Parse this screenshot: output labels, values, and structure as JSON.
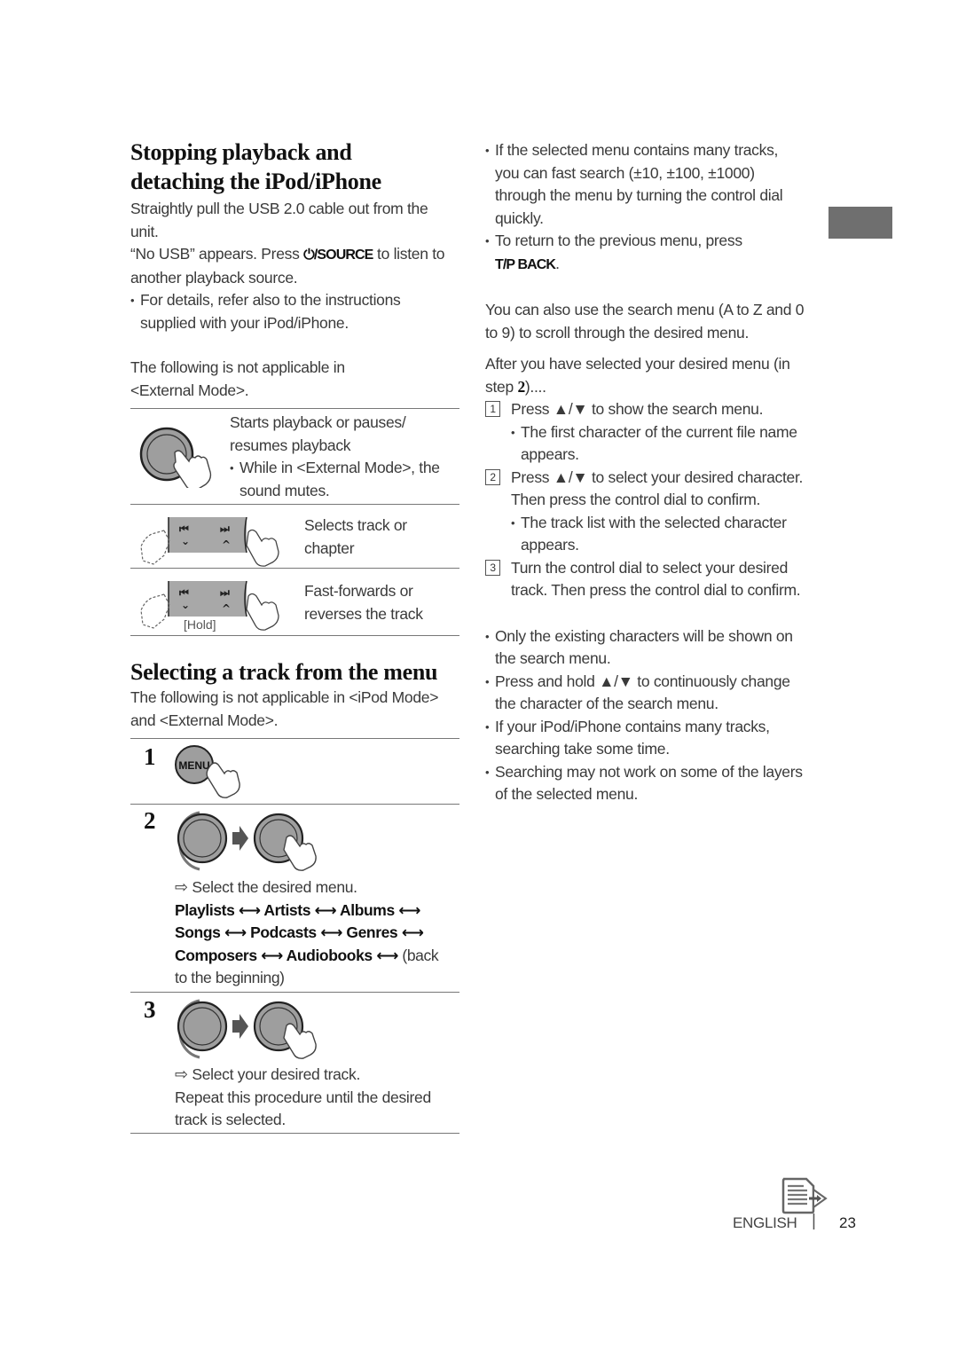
{
  "left": {
    "section1": {
      "title_line1": "Stopping playback and",
      "title_line2": "detaching the iPod/iPhone",
      "p1_line1": "Straightly pull the USB 2.0 cable out from the",
      "p1_line2": "unit.",
      "p2_pre": "“No USB” appears. Press ",
      "p2_key": "/SOURCE",
      "p2_post": " to listen to",
      "p2_line2": "another playback source.",
      "bullet_line1": "For details, refer also to the instructions",
      "bullet_line2": "supplied with your iPod/iPhone.",
      "note_line1": "The following is not applicable in",
      "note_line2": "<External Mode>.",
      "rows": [
        {
          "line1": "Starts playback or pauses/",
          "line2": "resumes playback",
          "bullet1": "While in <External Mode>, the",
          "bullet2": "sound mutes."
        },
        {
          "line1": "Selects track or",
          "line2": "chapter"
        },
        {
          "line1": "Fast-forwards or",
          "line2": "reverses the track",
          "hold": "[Hold]"
        }
      ]
    },
    "section2": {
      "title": "Selecting a track from the menu",
      "note_line1": "The following is not applicable in <iPod Mode>",
      "note_line2": "and <External Mode>.",
      "menu_button": "MENU",
      "steps": [
        {
          "num": "1"
        },
        {
          "num": "2",
          "result": "Select the desired menu.",
          "menu_items": [
            "Playlists",
            "Artists",
            "Albums",
            "Songs",
            "Podcasts",
            "Genres",
            "Composers",
            "Audiobooks"
          ],
          "tail_a": "(back",
          "tail_b": "to the beginning)"
        },
        {
          "num": "3",
          "result": "Select your desired track.",
          "line1": "Repeat this procedure until the desired",
          "line2": "track is selected."
        }
      ]
    }
  },
  "right": {
    "b1_l1": "If the selected menu contains many tracks,",
    "b1_l2": "you can fast search (±10, ±100, ±1000)",
    "b1_l3": "through the menu by turning the control dial",
    "b1_l4": "quickly.",
    "b2_l1": "To return to the previous menu, press",
    "b2_key": "T/P BACK",
    "p1_l1": "You can also use the search menu (A to Z and 0",
    "p1_l2": "to 9) to scroll through the desired menu.",
    "p2_l1": "After you have selected your desired menu (in",
    "p2_l2_pre": "step ",
    "p2_l2_bold": "2",
    "p2_l2_post": ")....",
    "steps": [
      {
        "num": "1",
        "line1": "Press ▲/▼ to show the search menu.",
        "sub1": "The first character of the current file name",
        "sub2": "appears."
      },
      {
        "num": "2",
        "line1": "Press ▲/▼ to select your desired character.",
        "line2": "Then press the control dial to confirm.",
        "sub1": "The track list with the selected character",
        "sub2": "appears."
      },
      {
        "num": "3",
        "line1": "Turn the control dial to select your desired",
        "line2": "track. Then press the control dial to confirm."
      }
    ],
    "notes": [
      {
        "l1": "Only the existing characters will be shown on",
        "l2": "the search menu."
      },
      {
        "l1": "Press and hold ▲/▼ to continuously change",
        "l2": "the character of the search menu."
      },
      {
        "l1": "If your iPod/iPhone contains many tracks,",
        "l2": "searching take some time."
      },
      {
        "l1": "Searching may not work on some of the layers",
        "l2": "of the selected menu."
      }
    ]
  },
  "footer": {
    "language": "ENGLISH",
    "separator": "|",
    "page_number": "23",
    "icon": "next-page-document-icon"
  },
  "colors": {
    "side_tab": "#6f6f6f",
    "knob_fill": "#9e9e9e",
    "button_bar": "#a8a8a8",
    "rule": "#777777"
  }
}
